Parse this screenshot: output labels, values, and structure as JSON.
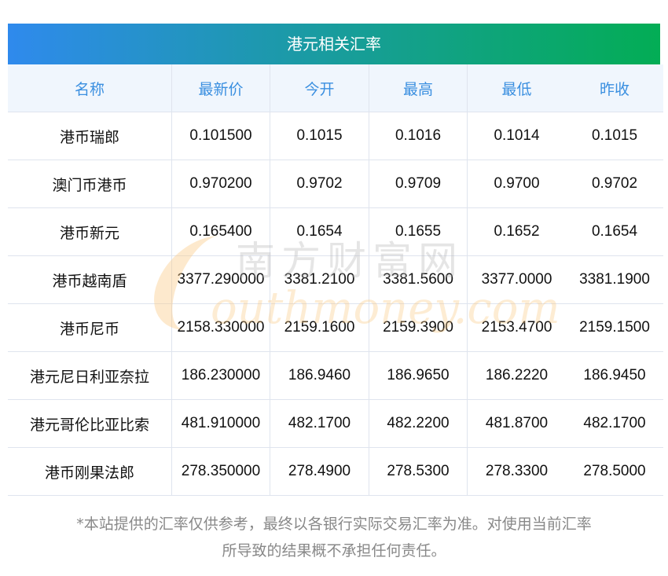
{
  "title": "港元相关汇率",
  "headers": [
    "名称",
    "最新价",
    "今开",
    "最高",
    "最低",
    "昨收"
  ],
  "rows": [
    [
      "港币瑞郎",
      "0.101500",
      "0.1015",
      "0.1016",
      "0.1014",
      "0.1015"
    ],
    [
      "澳门币港币",
      "0.970200",
      "0.9702",
      "0.9709",
      "0.9700",
      "0.9702"
    ],
    [
      "港币新元",
      "0.165400",
      "0.1654",
      "0.1655",
      "0.1652",
      "0.1654"
    ],
    [
      "港币越南盾",
      "3377.290000",
      "3381.2100",
      "3381.5600",
      "3377.0000",
      "3381.1900"
    ],
    [
      "港币尼币",
      "2158.330000",
      "2159.1600",
      "2159.3900",
      "2153.4700",
      "2159.1500"
    ],
    [
      "港元尼日利亚奈拉",
      "186.230000",
      "186.9460",
      "186.9650",
      "186.2220",
      "186.9450"
    ],
    [
      "港元哥伦比亚比索",
      "481.910000",
      "482.1700",
      "482.2200",
      "481.8700",
      "482.1700"
    ],
    [
      "港币刚果法郎",
      "278.350000",
      "278.4900",
      "278.5300",
      "278.3300",
      "278.5000"
    ]
  ],
  "watermark": {
    "cn": "南方财富网",
    "en": "outhmoney.com"
  },
  "footer": [
    "*本站提供的汇率仅供参考，最终以各银行实际交易汇率为准。对使用当前汇率",
    "所导致的结果概不承担任何责任。"
  ]
}
